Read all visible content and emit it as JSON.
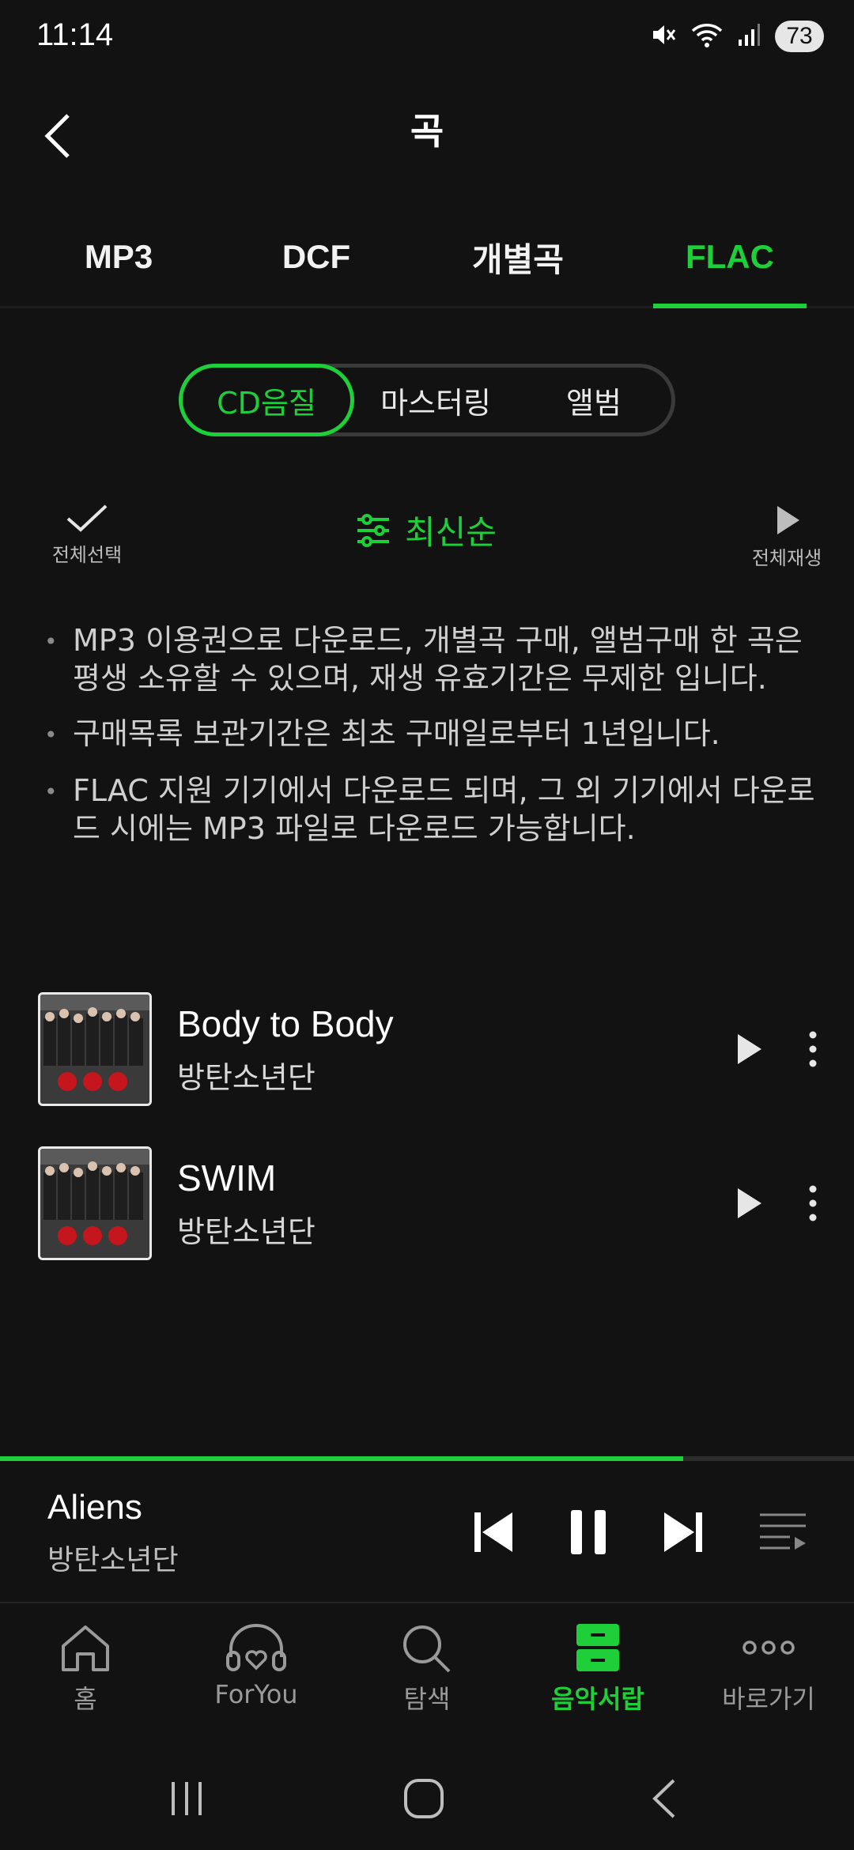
{
  "status_bar": {
    "time": "11:14",
    "battery": "73",
    "icons": [
      "mute-icon",
      "wifi-icon",
      "signal-icon"
    ]
  },
  "header": {
    "title": "곡",
    "back_icon": "chevron-left-icon"
  },
  "format_tabs": [
    {
      "label": "MP3",
      "active": false
    },
    {
      "label": "DCF",
      "active": false
    },
    {
      "label": "개별곡",
      "active": false
    },
    {
      "label": "FLAC",
      "active": true
    }
  ],
  "quality_segment": [
    {
      "label": "CD음질",
      "active": true
    },
    {
      "label": "마스터링",
      "active": false
    },
    {
      "label": "앨범",
      "active": false
    }
  ],
  "controls": {
    "select_all_label": "전체선택",
    "sort_label": "최신순",
    "play_all_label": "전체재생"
  },
  "notices": [
    "MP3 이용권으로 다운로드, 개별곡 구매, 앨범구매 한 곡은 평생 소유할 수 있으며, 재생 유효기간은 무제한 입니다.",
    "구매목록 보관기간은 최초 구매일로부터 1년입니다.",
    "FLAC 지원 기기에서 다운로드 되며, 그 외 기기에서 다운로드 시에는 MP3 파일로 다운로드 가능합니다."
  ],
  "songs": [
    {
      "title": "Body to Body",
      "artist": "방탄소년단"
    },
    {
      "title": "SWIM",
      "artist": "방탄소년단"
    }
  ],
  "now_playing": {
    "title": "Aliens",
    "artist": "방탄소년단",
    "progress": 0.8
  },
  "bottom_nav": [
    {
      "label": "홈",
      "icon": "home-icon",
      "active": false
    },
    {
      "label": "ForYou",
      "icon": "headphones-heart-icon",
      "active": false
    },
    {
      "label": "탐색",
      "icon": "search-icon",
      "active": false
    },
    {
      "label": "음악서랍",
      "icon": "drawer-icon",
      "active": true
    },
    {
      "label": "바로가기",
      "icon": "more-dots-icon",
      "active": false
    }
  ],
  "colors": {
    "accent": "#1fcf3a",
    "background": "#121212"
  }
}
